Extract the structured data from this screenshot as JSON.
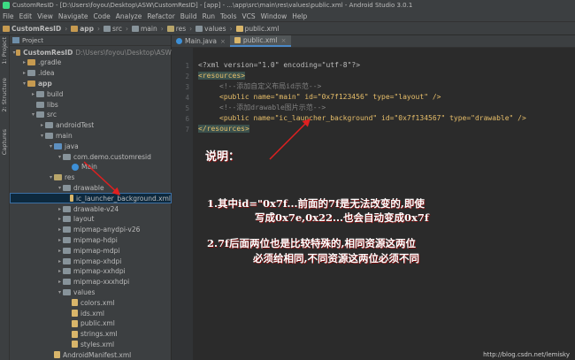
{
  "window": {
    "title": "CustomResID - [D:\\Users\\foyou\\Desktop\\ASW\\CustomResID] - [app] - ...\\app\\src\\main\\res\\values\\public.xml - Android Studio 3.0.1"
  },
  "menu": [
    "File",
    "Edit",
    "View",
    "Navigate",
    "Code",
    "Analyze",
    "Refactor",
    "Build",
    "Run",
    "Tools",
    "VCS",
    "Window",
    "Help"
  ],
  "breadcrumbs": [
    "CustomResID",
    "app",
    "src",
    "main",
    "res",
    "values",
    "public.xml"
  ],
  "side_tabs": [
    "1: Project",
    "2: Structure",
    "Captures"
  ],
  "project_panel": {
    "header": "Project",
    "tree": [
      {
        "label": "CustomResID",
        "path": "D:\\Users\\foyou\\Desktop\\ASW",
        "depth": 0,
        "arrow": "▾",
        "icon": "folder-brown",
        "bold": true
      },
      {
        "label": ".gradle",
        "depth": 1,
        "arrow": "▸",
        "icon": "folder-brown"
      },
      {
        "label": ".idea",
        "depth": 1,
        "arrow": "▸",
        "icon": "folder"
      },
      {
        "label": "app",
        "depth": 1,
        "arrow": "▾",
        "icon": "folder-brown",
        "bold": true
      },
      {
        "label": "build",
        "depth": 2,
        "arrow": "▸",
        "icon": "folder"
      },
      {
        "label": "libs",
        "depth": 2,
        "arrow": "",
        "icon": "folder"
      },
      {
        "label": "src",
        "depth": 2,
        "arrow": "▾",
        "icon": "folder"
      },
      {
        "label": "androidTest",
        "depth": 3,
        "arrow": "▸",
        "icon": "folder"
      },
      {
        "label": "main",
        "depth": 3,
        "arrow": "▾",
        "icon": "folder"
      },
      {
        "label": "java",
        "depth": 4,
        "arrow": "▾",
        "icon": "folder-blue"
      },
      {
        "label": "com.demo.customresid",
        "depth": 5,
        "arrow": "▾",
        "icon": "folder"
      },
      {
        "label": "Main",
        "depth": 6,
        "arrow": "",
        "icon": "class"
      },
      {
        "label": "res",
        "depth": 4,
        "arrow": "▾",
        "icon": "folder-res"
      },
      {
        "label": "drawable",
        "depth": 5,
        "arrow": "▾",
        "icon": "folder"
      },
      {
        "label": "ic_launcher_background.xml",
        "depth": 6,
        "arrow": "",
        "icon": "file",
        "selected": true
      },
      {
        "label": "drawable-v24",
        "depth": 5,
        "arrow": "▸",
        "icon": "folder"
      },
      {
        "label": "layout",
        "depth": 5,
        "arrow": "▸",
        "icon": "folder"
      },
      {
        "label": "mipmap-anydpi-v26",
        "depth": 5,
        "arrow": "▸",
        "icon": "folder"
      },
      {
        "label": "mipmap-hdpi",
        "depth": 5,
        "arrow": "▸",
        "icon": "folder"
      },
      {
        "label": "mipmap-mdpi",
        "depth": 5,
        "arrow": "▸",
        "icon": "folder"
      },
      {
        "label": "mipmap-xhdpi",
        "depth": 5,
        "arrow": "▸",
        "icon": "folder"
      },
      {
        "label": "mipmap-xxhdpi",
        "depth": 5,
        "arrow": "▸",
        "icon": "folder"
      },
      {
        "label": "mipmap-xxxhdpi",
        "depth": 5,
        "arrow": "▸",
        "icon": "folder"
      },
      {
        "label": "values",
        "depth": 5,
        "arrow": "▾",
        "icon": "folder"
      },
      {
        "label": "colors.xml",
        "depth": 6,
        "arrow": "",
        "icon": "file"
      },
      {
        "label": "ids.xml",
        "depth": 6,
        "arrow": "",
        "icon": "file"
      },
      {
        "label": "public.xml",
        "depth": 6,
        "arrow": "",
        "icon": "file"
      },
      {
        "label": "strings.xml",
        "depth": 6,
        "arrow": "",
        "icon": "file"
      },
      {
        "label": "styles.xml",
        "depth": 6,
        "arrow": "",
        "icon": "file"
      },
      {
        "label": "AndroidManifest.xml",
        "depth": 4,
        "arrow": "",
        "icon": "file"
      }
    ]
  },
  "editor": {
    "tabs": [
      {
        "label": "Main.java",
        "active": false
      },
      {
        "label": "public.xml",
        "active": true
      }
    ],
    "line_numbers": [
      "1",
      "2",
      "3",
      "4",
      "5",
      "6",
      "7"
    ],
    "lines": {
      "l1": "<?xml version=\"1.0\" encoding=\"utf-8\"?>",
      "l2": "<resources>",
      "l3": "<!--添加自定义布局id示范-->",
      "l4a": "<public name=\"main\" id=\"0x7f123456\" type=\"layout\" />",
      "l5": "<!--添加drawable图片示范-->",
      "l6a": "<public name=\"ic_launcher_background\" id=\"0x7f134567\" type=\"drawable\" />",
      "l7": "</resources>"
    }
  },
  "annotations": {
    "heading": "说明：",
    "point1_line1": "1.其中id=\"0x7f...前面的7f是无法改变的,即使",
    "point1_line2": "写成0x7e,0x22...也会自动变成0x7f",
    "point2_line1": "2.7f后面两位也是比较特殊的,相同资源这两位",
    "point2_line2": "必须给相同,不同资源这两位必须不同",
    "arrow_color": "#e02020"
  },
  "watermark": "http://blog.csdn.net/lemisky",
  "colors": {
    "tag": "#e8bf6a",
    "value": "#a5c25c",
    "comment": "#808080",
    "background": "#2b2b2b",
    "panel": "#3c3f41"
  }
}
